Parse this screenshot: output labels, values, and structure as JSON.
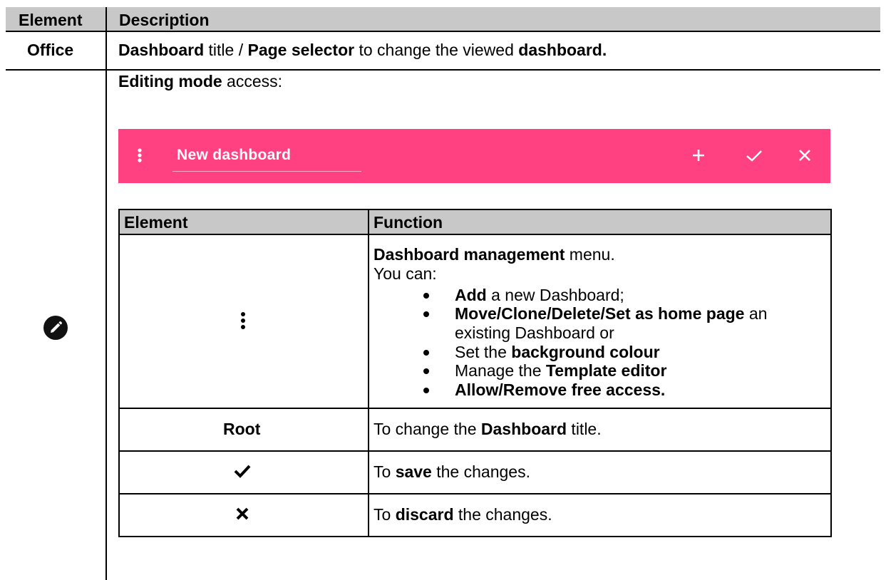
{
  "outer_table": {
    "headers": {
      "element": "Element",
      "description": "Description"
    },
    "row1": {
      "element": "Office",
      "description_parts": [
        "Dashboard",
        " title / ",
        "Page selector",
        " to change the viewed ",
        "dashboard."
      ]
    },
    "row2": {
      "element_icon": "pencil-edit-icon",
      "intro_bold": "Editing mode",
      "intro_rest": " access:"
    }
  },
  "editing_bar": {
    "color": "#ff4081",
    "menu_icon": "more-vertical-icon",
    "title_value": "New dashboard",
    "add_icon": "plus-icon",
    "save_icon": "check-icon",
    "discard_icon": "close-icon"
  },
  "inner_table": {
    "headers": {
      "element": "Element",
      "function": "Function"
    },
    "rows": [
      {
        "element_icon": "more-vertical-icon",
        "title_bold": "Dashboard management",
        "title_rest": " menu.",
        "lead": "You can:",
        "bullets": [
          {
            "b1": "Add",
            "r1": " a new Dashboard;"
          },
          {
            "b1": "Move/Clone/Delete/Set as home page",
            "r1": " an"
          },
          {
            "cont": "existing Dashboard or"
          },
          {
            "r0": "Set the ",
            "b1": "background colour"
          },
          {
            "r0": "Manage the ",
            "b1": "Template editor"
          },
          {
            "b1": "Allow/Remove free access."
          }
        ]
      },
      {
        "element": "Root",
        "f0": "To change the ",
        "fb": "Dashboard",
        "f1": " title."
      },
      {
        "element_icon": "check-icon",
        "f0": "To ",
        "fb": "save",
        "f1": " the changes."
      },
      {
        "element_icon": "close-icon",
        "f0": "To ",
        "fb": "discard",
        "f1": " the changes."
      }
    ]
  }
}
